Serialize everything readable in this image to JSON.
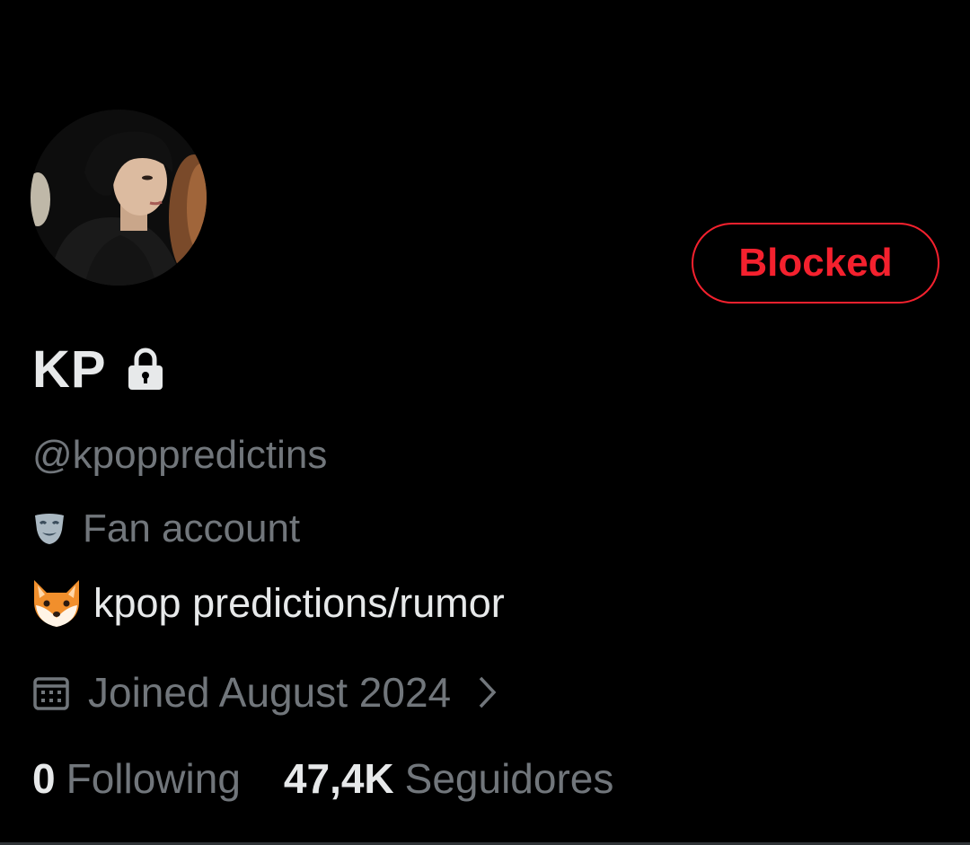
{
  "profile": {
    "display_name": "KP",
    "handle": "@kpoppredictins",
    "label": "Fan account",
    "bio": "kpop predictions/rumor",
    "joined": "Joined August 2024",
    "avatar_icon": "avatar-photo",
    "name_badge_icon": "lock-icon",
    "label_icon": "theater-masks-icon",
    "bio_emoji_icon": "fox-face-icon"
  },
  "actions": {
    "blocked_label": "Blocked"
  },
  "stats": {
    "following_value": "0",
    "following_label": "Following",
    "followers_value": "47,4K",
    "followers_label": "Seguidores"
  },
  "colors": {
    "background": "#000000",
    "primary_text": "#e7e9ea",
    "secondary_text": "#71767b",
    "blocked_red": "#f4212e",
    "divider": "#2f3336"
  }
}
